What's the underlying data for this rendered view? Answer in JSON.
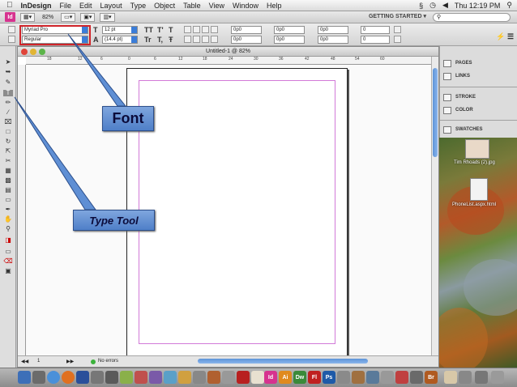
{
  "menubar": {
    "app_name": "InDesign",
    "items": [
      "File",
      "Edit",
      "Layout",
      "Type",
      "Object",
      "Table",
      "View",
      "Window",
      "Help"
    ],
    "clock": "Thu 12:19 PM"
  },
  "appbar": {
    "logo": "Id",
    "zoom": "82%",
    "workspace": "GETTING STARTED ▾"
  },
  "control": {
    "font_family": "Myriad Pro",
    "font_style": "Regular",
    "font_size": "12 pt",
    "leading": "(14.4 pt)",
    "spacing_fields": [
      "0p0",
      "0p0",
      "0p0",
      "0p0",
      "0p0",
      "0p0"
    ],
    "count_fields": [
      "0",
      "0"
    ],
    "style_glyphs": [
      "TT",
      "T'",
      "T",
      "Tr",
      "T,",
      "Ŧ"
    ]
  },
  "document": {
    "title": "Untitled-1 @ 82%",
    "ruler_ticks": [
      "18",
      "12",
      "6",
      "0",
      "6",
      "12",
      "18",
      "24",
      "30",
      "36",
      "42",
      "48",
      "54",
      "60"
    ],
    "status_page": "1",
    "status_text": "No errors"
  },
  "panels": {
    "items": [
      {
        "label": "PAGES",
        "icon": "pages-icon"
      },
      {
        "label": "LINKS",
        "icon": "links-icon"
      },
      {
        "label": "STROKE",
        "icon": "stroke-icon"
      },
      {
        "label": "COLOR",
        "icon": "color-icon"
      },
      {
        "label": "SWATCHES",
        "icon": "swatches-icon"
      }
    ]
  },
  "desktop": {
    "file1": "Tim Rhoads (2).jpg",
    "file2": "PhoneList.aspx.html"
  },
  "callouts": {
    "font": "Font",
    "type_tool": "Type Tool"
  },
  "dock_apps": [
    "Id",
    "Ai",
    "Dw",
    "Fl",
    "Ps",
    "Br"
  ],
  "colors": {
    "indesign": "#d6338f",
    "callout": "#5f8fd4",
    "highlight": "#d0242a",
    "margin_guide": "#d27ad8"
  }
}
